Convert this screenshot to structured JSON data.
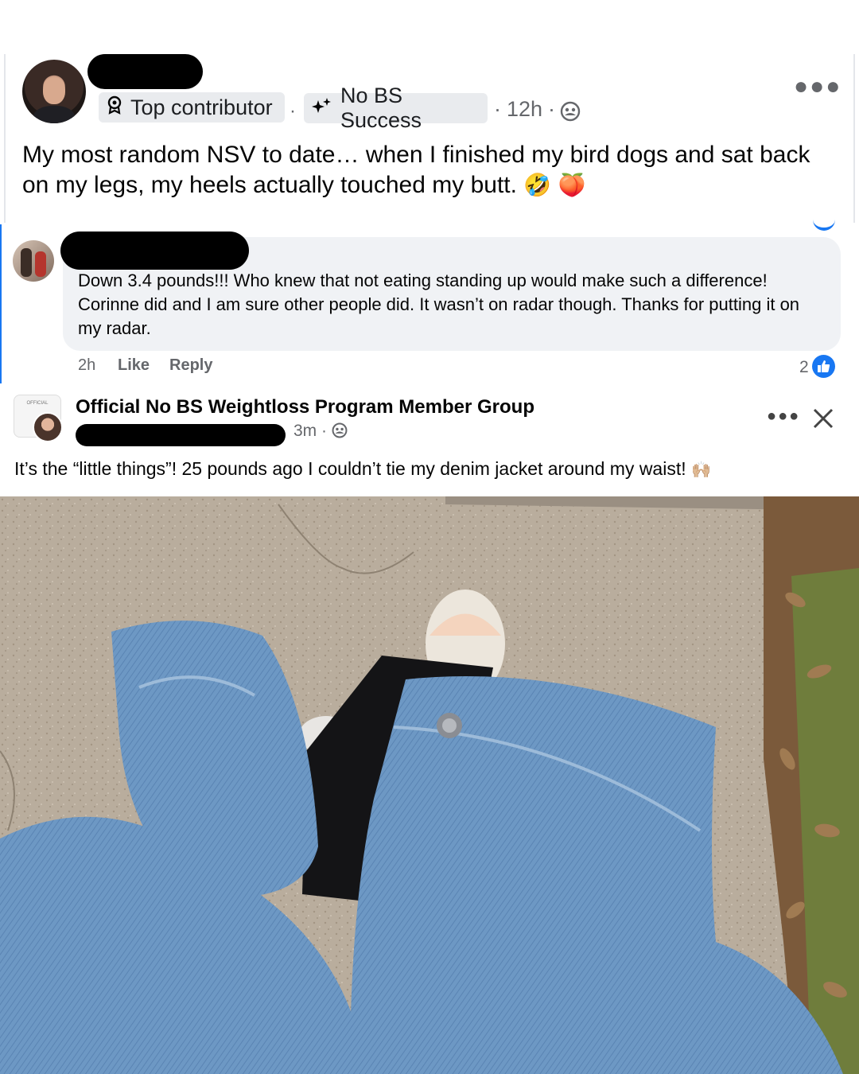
{
  "post1": {
    "badge_top_contributor": "Top contributor",
    "badge_group_tag": "No BS Success",
    "time": "12h",
    "separator": "·",
    "body": "My most random NSV to date… when I finished my bird dogs and sat back on my legs, my heels actually touched my butt.",
    "emojis": [
      "🤣",
      "🍑"
    ]
  },
  "comment": {
    "body": "Down 3.4 pounds!!! Who knew that not eating standing up would make such a difference! Corinne did and I am sure other people did. It wasn’t on radar though. Thanks for putting it on my radar.",
    "time": "2h",
    "like_label": "Like",
    "reply_label": "Reply",
    "like_count": "2"
  },
  "post2": {
    "group_name": "Official No BS Weightloss Program Member Group",
    "time": "3m",
    "separator": "·",
    "body": "It’s the “little things”! 25 pounds ago I couldn’t tie my denim jacket around my waist!",
    "emoji": "🙌🏼",
    "logo_text": "OFFICIAL"
  },
  "icons": {
    "more": "more-options-icon",
    "close": "close-icon",
    "audience": "group-audience-icon",
    "badge": "top-contributor-icon",
    "tag": "sparkle-icon",
    "like": "thumbs-up-icon"
  },
  "colors": {
    "accent": "#1877f2",
    "bubble": "#f0f2f5",
    "meta": "#65676b"
  }
}
